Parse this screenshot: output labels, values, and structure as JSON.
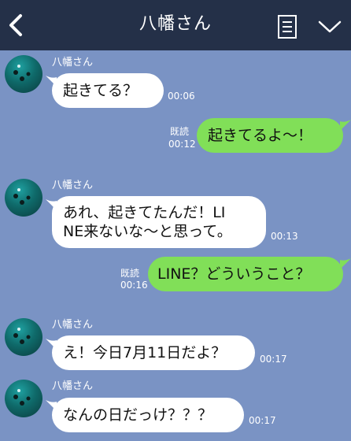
{
  "header": {
    "title": "八幡さん",
    "back_icon": "chevron-left-icon",
    "notes_icon": "notes-icon",
    "menu_icon": "chevron-down-icon",
    "background": "#243048"
  },
  "chat": {
    "background": "#7a93c4",
    "incoming_bubble_color": "#ffffff",
    "outgoing_bubble_color": "#81df58"
  },
  "messages": [
    {
      "direction": "incoming",
      "sender": "八幡さん",
      "text": "起きてる？",
      "time": "00:06"
    },
    {
      "direction": "outgoing",
      "read": "既読",
      "text": "起きてるよ〜！",
      "time": "00:12"
    },
    {
      "direction": "incoming",
      "sender": "八幡さん",
      "text_line1": "あれ、起きてたんだ！LI",
      "text_line2": "NE来ないな〜と思って。",
      "time": "00:13"
    },
    {
      "direction": "outgoing",
      "read": "既読",
      "text": "LINE？どういうこと？",
      "time": "00:16"
    },
    {
      "direction": "incoming",
      "sender": "八幡さん",
      "text": "え！今日7月11日だよ？",
      "time": "00:17"
    },
    {
      "direction": "incoming",
      "sender": "八幡さん",
      "text": "なんの日だっけ？？？",
      "time": "00:17"
    }
  ]
}
